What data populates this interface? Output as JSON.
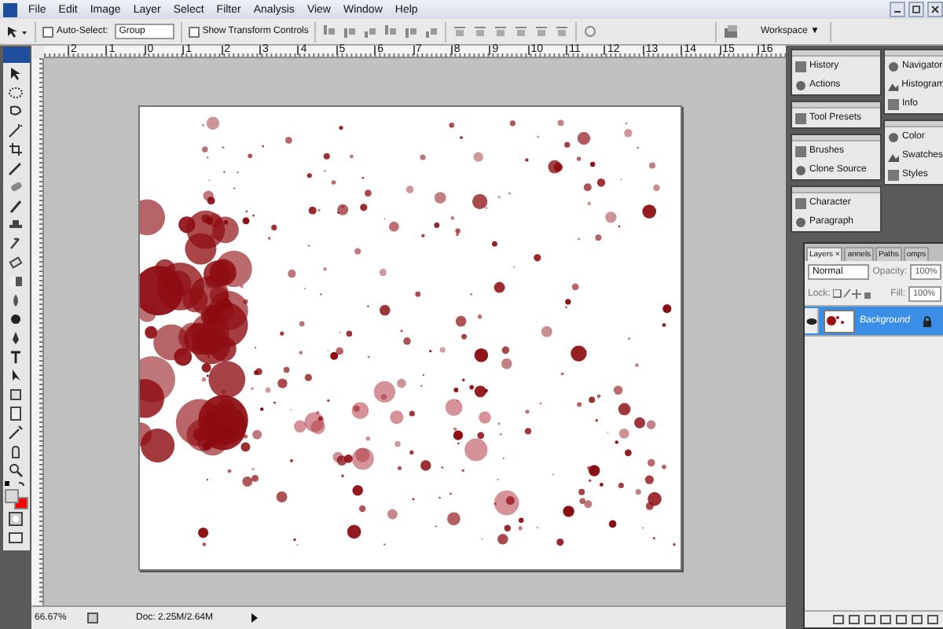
{
  "menu": [
    "File",
    "Edit",
    "Image",
    "Layer",
    "Select",
    "Filter",
    "Analysis",
    "View",
    "Window",
    "Help"
  ],
  "options_bar": {
    "auto_select": {
      "label": "Auto-Select:",
      "checked": false
    },
    "auto_select_mode": "Group",
    "transform_controls": {
      "label": "Show Transform Controls",
      "checked": false
    },
    "workspace": {
      "label": "Workspace",
      "caret": "▼"
    }
  },
  "ruler_labels": [
    "2",
    "1",
    "0",
    "1",
    "2",
    "3",
    "4",
    "5",
    "6",
    "7",
    "8",
    "9",
    "10",
    "11",
    "12",
    "13",
    "14",
    "15",
    "16"
  ],
  "dock_columns": [
    {
      "groups": [
        {
          "items": [
            "History",
            "Actions"
          ]
        },
        {
          "items": [
            "Tool Presets"
          ]
        },
        {
          "items": [
            "Brushes",
            "Clone Source"
          ]
        },
        {
          "items": [
            "Character",
            "Paragraph"
          ]
        }
      ]
    },
    {
      "groups": [
        {
          "items": [
            "Navigator",
            "Histogram",
            "Info"
          ]
        },
        {
          "items": [
            "Color",
            "Swatches",
            "Styles"
          ]
        }
      ]
    }
  ],
  "layers_panel": {
    "tabs": [
      {
        "label": "Layers",
        "close": "×",
        "selected": true
      },
      {
        "label": "annels",
        "selected": false
      },
      {
        "label": "Paths",
        "selected": false
      },
      {
        "label": "omps",
        "selected": false
      }
    ],
    "blend_mode": "Normal",
    "opacity_label": "Opacity:",
    "opacity": "100%",
    "lock_label": "Lock:",
    "fill_label": "Fill:",
    "fill": "100%",
    "layers": [
      {
        "name": "Background",
        "selected": true,
        "visible": true,
        "locked": true
      }
    ]
  },
  "status_bar": {
    "zoom": "66.67%",
    "doc": "Doc: 2.25M/2.64M"
  }
}
